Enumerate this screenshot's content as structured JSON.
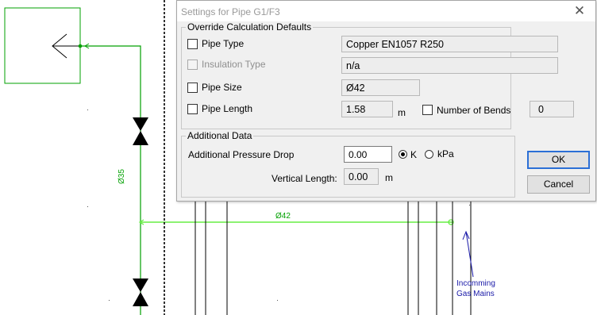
{
  "dialog": {
    "title": "Settings for Pipe G1/F3",
    "close_glyph": "✕",
    "override_group": {
      "title": "Override Calculation Defaults",
      "pipe_type": {
        "label": "Pipe Type",
        "checked": false,
        "value": "Copper EN1057 R250"
      },
      "insulation_type": {
        "label": "Insulation Type",
        "checked": false,
        "disabled": true,
        "value": "n/a"
      },
      "pipe_size": {
        "label": "Pipe Size",
        "checked": false,
        "value": "Ø42"
      },
      "pipe_length": {
        "label": "Pipe Length",
        "checked": false,
        "value": "1.58",
        "unit": "m"
      },
      "number_of_bends": {
        "label": "Number of Bends",
        "checked": false,
        "value": "0"
      }
    },
    "additional_group": {
      "title": "Additional Data",
      "pressure_drop": {
        "label": "Additional Pressure Drop",
        "value": "0.00"
      },
      "unit_k": {
        "label": "K",
        "selected": true
      },
      "unit_kpa": {
        "label": "kPa",
        "selected": false
      },
      "vertical_length": {
        "label": "Vertical Length:",
        "value": "0.00",
        "unit": "m"
      }
    },
    "ok_label": "OK",
    "cancel_label": "Cancel"
  },
  "diagram": {
    "pipe_label_vertical": "Ø35",
    "pipe_label_horizontal": "Ø42",
    "annotation": [
      "Incomming",
      "Gas Mains"
    ],
    "colors": {
      "pipe": "#00a000",
      "selected_pipe": "#66ee44",
      "annotation": "#1a1aa8",
      "wall": "#000000",
      "dialog_bg": "#f0f0f0",
      "default_button_border": "#2b6fd6"
    }
  }
}
